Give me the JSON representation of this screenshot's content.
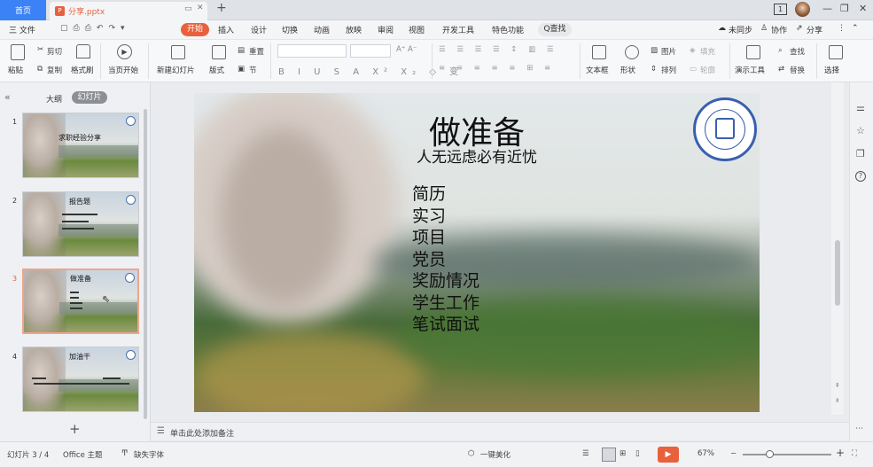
{
  "titlebar": {
    "home_tab": "首页",
    "doc_tab": "分享.pptx",
    "new_tab": "+",
    "badge": "1"
  },
  "menubar": {
    "file_label": "三 文件",
    "items": [
      "开始",
      "插入",
      "设计",
      "切换",
      "动画",
      "放映",
      "审阅",
      "视图",
      "开发工具",
      "特色功能"
    ],
    "search_label": "Q查找",
    "unsynced": "未同步",
    "collab": "协作",
    "share": "分享"
  },
  "ribbon": {
    "paste": "粘贴",
    "cut": "剪切",
    "copy": "复制",
    "format_painter": "格式刷",
    "play_from_current": "当页开始",
    "new_slide": "新建幻灯片",
    "layout": "版式",
    "reset": "重置",
    "section": "节",
    "text_box": "文本框",
    "shape": "形状",
    "image": "图片",
    "fill": "填充",
    "arrange": "排列",
    "outline": "轮廓",
    "present_tools": "演示工具",
    "find": "查找",
    "replace": "替换",
    "select": "选择"
  },
  "leftpanel": {
    "outline_tab": "大纲",
    "slides_tab": "幻灯片",
    "thumbs": [
      {
        "num": "1",
        "title": "求职经验分享"
      },
      {
        "num": "2",
        "title": "报告题"
      },
      {
        "num": "3",
        "title": "做准备"
      },
      {
        "num": "4",
        "title": "加油干"
      }
    ],
    "add": "+"
  },
  "slide": {
    "title": "做准备",
    "subtitle": "人无远虑必有近忧",
    "items": [
      "简历",
      "实习",
      "项目",
      "党员",
      "奖励情况",
      "学生工作",
      "笔试面试"
    ]
  },
  "notes": {
    "placeholder": "单击此处添加备注"
  },
  "status": {
    "slide_counter": "幻灯片 3 / 4",
    "theme": "Office 主题",
    "missing_font": "缺失字体",
    "beautify": "一键美化",
    "zoom": "67%",
    "minus": "−",
    "plus": "+"
  },
  "colors": {
    "accent": "#e8613c",
    "home_tab": "#3b82f6"
  }
}
